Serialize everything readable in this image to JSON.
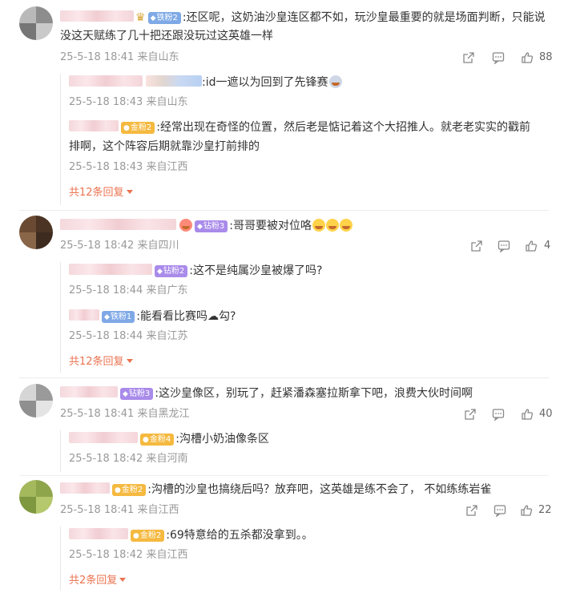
{
  "colors": {
    "accent": "#eb7350",
    "meta": "#999999",
    "text": "#333333",
    "iron_badge": "#7fa9e6",
    "gold_badge": "#f5b940",
    "diamond_badge": "#a98bea"
  },
  "icons": {
    "share": "share-icon",
    "comment": "comment-icon",
    "like": "thumbs-up-icon"
  },
  "comments": [
    {
      "badge": "铁粉2",
      "text": ":还区呢，这奶油沙皇连区都不如，玩沙皇最重要的就是场面判断，只能说",
      "text2": "没这天赋练了几十把还跟没玩过这英雄一样",
      "meta": "25-5-18 18:41 来自山东",
      "likes": "88",
      "replies": [
        {
          "text": ":id一遮以为回到了先锋赛",
          "meta": "25-5-18 18:43 来自山东"
        },
        {
          "badge": "金粉2",
          "text": ":经常出现在奇怪的位置，然后老是惦记着这个大招推人。就老老实实的戳前",
          "text2": "排啊，这个阵容后期就靠沙皇打前排的",
          "meta": "25-5-18 18:43 来自江西"
        }
      ],
      "more": "共12条回复"
    },
    {
      "badge": "钻粉3",
      "text": ":哥哥要被对位咯",
      "meta": "25-5-18 18:42 来自四川",
      "likes": "4",
      "replies": [
        {
          "badge": "钻粉2",
          "text": ":这不是纯属沙皇被爆了吗?",
          "meta": "25-5-18 18:44 来自广东"
        },
        {
          "badge": "铁粉1",
          "text": ":能看看比赛吗☁勾?",
          "meta": "25-5-18 18:44 来自江苏"
        }
      ],
      "more": "共12条回复"
    },
    {
      "badge": "钻粉3",
      "text": ":这沙皇像区，别玩了，赶紧潘森塞拉斯拿下吧，浪费大伙时间啊",
      "meta": "25-5-18 18:41 来自黑龙江",
      "likes": "40",
      "replies": [
        {
          "badge": "金粉4",
          "text": ":沟槽小奶油像条区",
          "meta": "25-5-18 18:42 来自河南"
        }
      ]
    },
    {
      "badge": "金粉2",
      "text": ":沟槽的沙皇也搞绕后吗？放弃吧，这英雄是练不会了， 不如练练岩雀",
      "meta": "25-5-18 18:41 来自江西",
      "likes": "22",
      "replies": [
        {
          "badge": "金粉2",
          "text": ":69特意给的五杀都没拿到。。",
          "meta": "25-5-18 18:42 来自江西"
        }
      ],
      "more": "共2条回复"
    }
  ]
}
